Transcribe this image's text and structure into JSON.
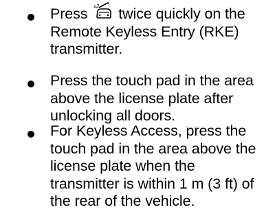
{
  "instructions": {
    "items": [
      {
        "icon": "liftgate-icon",
        "lines": [
          "Press",
          "twice quickly on the",
          "Remote Keyless Entry (RKE)",
          "transmitter."
        ]
      },
      {
        "lines": [
          "Press the touch pad in the area",
          "above the license plate after",
          "unlocking all doors."
        ]
      },
      {
        "lines": [
          "For Keyless Access, press the",
          "touch pad in the area above the",
          "license plate when the",
          "transmitter is within 1 m (3 ft) of",
          "the rear of the vehicle."
        ]
      }
    ]
  }
}
